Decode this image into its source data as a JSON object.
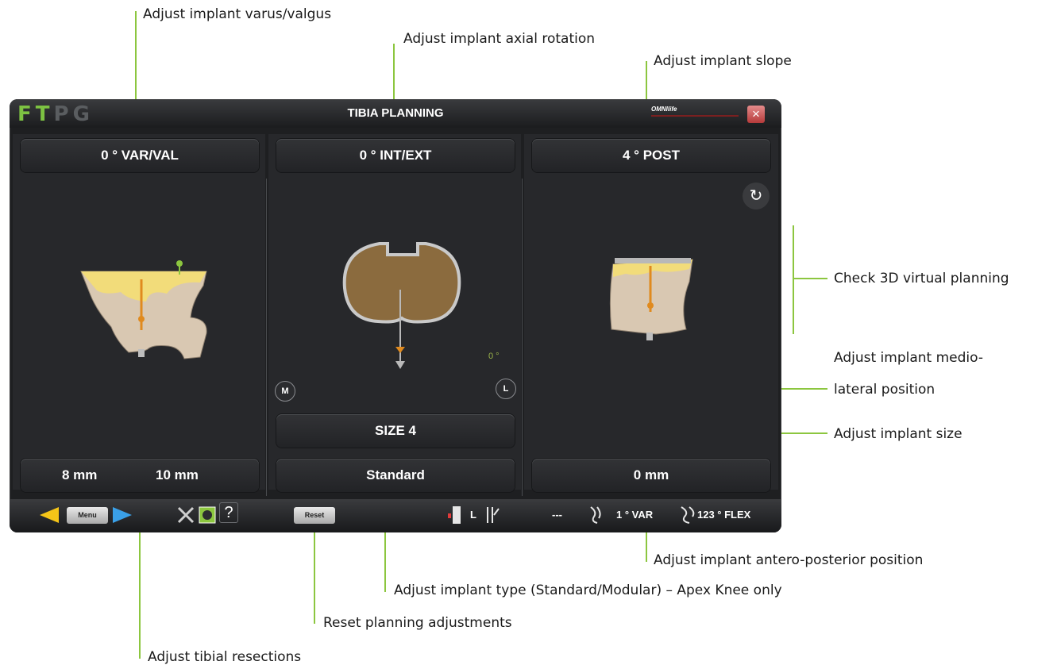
{
  "annotations": {
    "varus_valgus": "Adjust implant varus/valgus",
    "axial_rotation": "Adjust implant axial rotation",
    "slope": "Adjust implant slope",
    "check_3d": "Check 3D virtual planning",
    "medio_lateral_1": "Adjust implant medio-",
    "medio_lateral_2": "lateral position",
    "size": "Adjust implant size",
    "antero_posterior": "Adjust implant antero-posterior position",
    "implant_type": "Adjust implant type (Standard/Modular) – Apex Knee only",
    "reset": "Reset planning adjustments",
    "tibial_resections": "Adjust tibial resections"
  },
  "app": {
    "logo_letters": [
      "F",
      "T",
      "P",
      "G"
    ],
    "title": "TIBIA PLANNING",
    "brand": "OMNIlife",
    "close_icon": "×",
    "var_val": "0 ° VAR/VAL",
    "int_ext": "0 ° INT/EXT",
    "post": "4 ° POST",
    "m_button": "M",
    "l_button": "L",
    "degree_readout": "0 °",
    "size": "SIZE 4",
    "resection_left": "8 mm",
    "resection_right": "10 mm",
    "implant_type": "Standard",
    "ap_position": "0 mm",
    "bottom": {
      "menu_label": "Menu",
      "help_label": "?",
      "reset_label": "Reset",
      "side": "L",
      "dash": "---",
      "var": "1 ° VAR",
      "flex": "123 ° FLEX"
    }
  },
  "colors": {
    "accent_green": "#8cc63f",
    "logo_green": "#7dc242",
    "bone": "#d9c8b2",
    "cartilage": "#f2dc7a",
    "axis_orange": "#e08a1e",
    "nav_yellow": "#f5c518",
    "nav_blue": "#3aa0e8"
  }
}
